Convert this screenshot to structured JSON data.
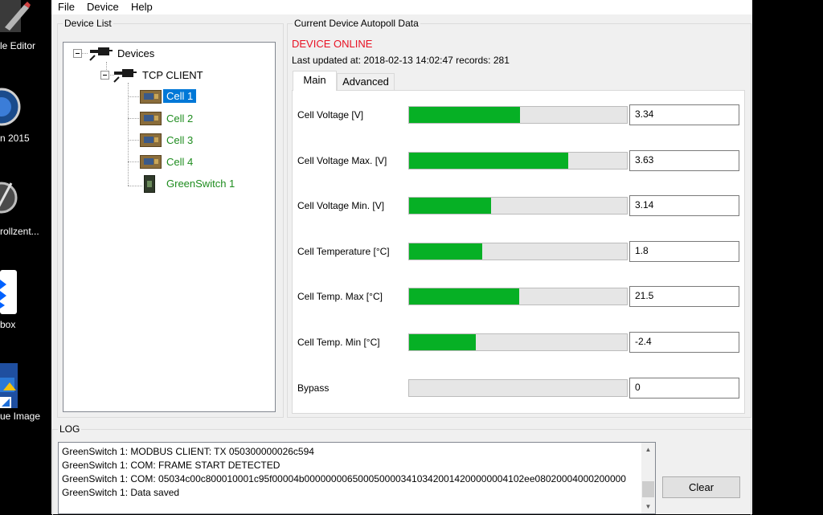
{
  "desktop": {
    "icons": [
      {
        "label": "le Editor",
        "icon": "editor-icon"
      },
      {
        "label": "n 2015",
        "icon": "app-2015-icon"
      },
      {
        "label": "rollzent...",
        "icon": "steuerung-icon"
      },
      {
        "label": "box",
        "icon": "dropbox-icon"
      },
      {
        "label": "ue Image",
        "icon": "image-shortcut-icon"
      }
    ]
  },
  "menubar": {
    "items": [
      "File",
      "Device",
      "Help"
    ]
  },
  "device_list": {
    "title": "Device List",
    "root": "Devices",
    "client": "TCP CLIENT",
    "children": [
      {
        "label": "Cell 1",
        "selected": true
      },
      {
        "label": "Cell 2"
      },
      {
        "label": "Cell 3"
      },
      {
        "label": "Cell 4"
      },
      {
        "label": "GreenSwitch 1"
      }
    ]
  },
  "autopoll": {
    "title": "Current Device Autopoll Data",
    "status": "DEVICE ONLINE",
    "status_color": "#e81123",
    "last_updated": "Last updated at: 2018-02-13 14:02:47 records: 281",
    "tabs": [
      "Main",
      "Advanced"
    ],
    "active_tab": "Main",
    "rows": [
      {
        "label": "Cell Voltage [V]",
        "value": "3.34",
        "fill": 0.51
      },
      {
        "label": "Cell Voltage Max. [V]",
        "value": "3.63",
        "fill": 0.73
      },
      {
        "label": "Cell Voltage Min. [V]",
        "value": "3.14",
        "fill": 0.375
      },
      {
        "label": "Cell Temperature [°C]",
        "value": "1.8",
        "fill": 0.335
      },
      {
        "label": "Cell Temp. Max [°C]",
        "value": "21.5",
        "fill": 0.505
      },
      {
        "label": "Cell Temp. Min [°C]",
        "value": "-2.4",
        "fill": 0.305
      },
      {
        "label": "Bypass",
        "value": "0",
        "fill": 0
      }
    ],
    "bar_color": "#06b025"
  },
  "log": {
    "title": "LOG",
    "lines": [
      "GreenSwitch 1: MODBUS CLIENT: TX 050300000026c594",
      "GreenSwitch 1: COM: FRAME START DETECTED",
      "GreenSwitch 1: COM: 05034c00c800010001c95f00004b00000000650005000034103420014200000004102ee08020004000200000",
      "GreenSwitch 1: Data saved"
    ],
    "clear_label": "Clear"
  }
}
